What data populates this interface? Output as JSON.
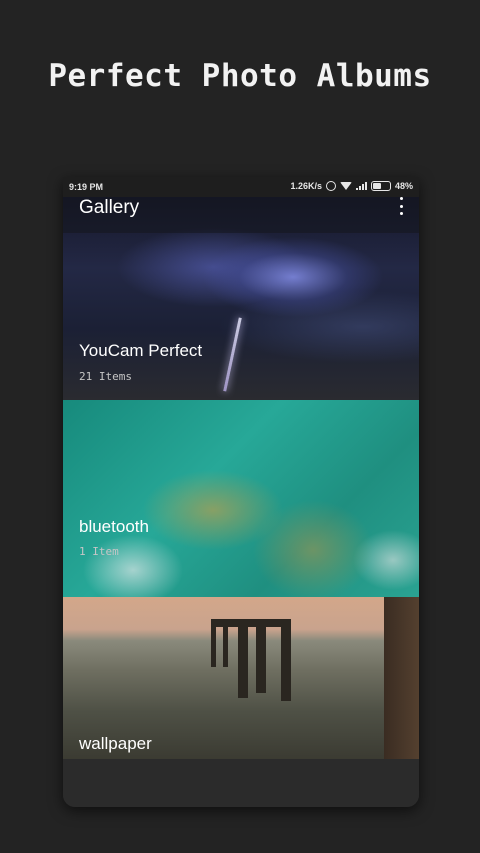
{
  "promo": {
    "title": "Perfect Photo Albums"
  },
  "status_bar": {
    "time": "9:19 PM",
    "speed": "1.26K/s",
    "battery": "48%"
  },
  "app_bar": {
    "title": "Gallery"
  },
  "albums": [
    {
      "name": "YouCam Perfect",
      "count": "21 Items"
    },
    {
      "name": "bluetooth",
      "count": "1 Item"
    },
    {
      "name": "wallpaper",
      "count": ""
    }
  ],
  "icons": [
    "alarm-icon",
    "wifi-icon",
    "signal-icon",
    "battery-icon",
    "more-vert-icon"
  ]
}
